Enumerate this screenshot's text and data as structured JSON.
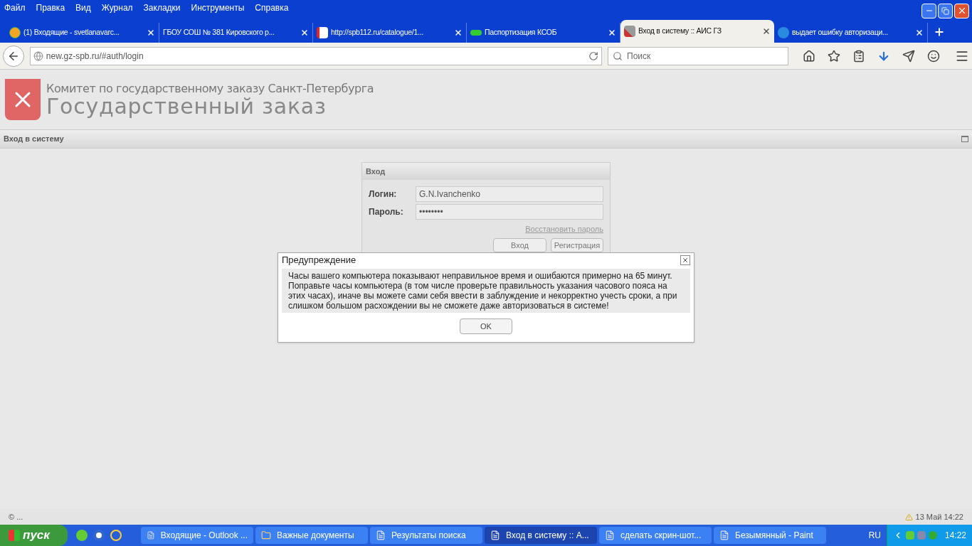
{
  "menu": [
    "Файл",
    "Правка",
    "Вид",
    "Журнал",
    "Закладки",
    "Инструменты",
    "Справка"
  ],
  "tabs": [
    {
      "label": "(1) Входящие - svetlanavarc...",
      "selected": false
    },
    {
      "label": "ГБОУ СОШ № 381 Кировского р...",
      "selected": false
    },
    {
      "label": "http://spb112.ru/catalogue/1...",
      "selected": false
    },
    {
      "label": "Паспортизация КСОБ",
      "selected": false
    },
    {
      "label": "Вход в систему :: АИС ГЗ",
      "selected": true
    },
    {
      "label": "выдает ошибку авторизаци...",
      "selected": false
    }
  ],
  "address": {
    "value": "new.gz-spb.ru/#auth/login"
  },
  "search": {
    "placeholder": "Поиск"
  },
  "header": {
    "org": "Комитет по государственному заказу Санкт-Петербурга",
    "title": "Государственный заказ"
  },
  "section_title": "Вход в систему",
  "login": {
    "title": "Вход",
    "fields": [
      {
        "label": "Логин:",
        "value": "G.N.Ivanchenko"
      },
      {
        "label": "Пароль:",
        "value": "••••••••"
      }
    ],
    "link": "Восстановить пароль",
    "buttons": [
      "Вход",
      "Регистрация"
    ]
  },
  "dialog": {
    "title": "Предупреждение",
    "message": "Часы вашего компьютера показывают неправильное время и ошибаются примерно на 65 минут. Поправьте часы компьютера (в том числе проверьте правильность указания часового пояса на этих часах), иначе вы можете сами себя ввести в заблуждение и некорректно учесть сроки, а при слишком большом расхождении вы не сможете даже авторизоваться в системе!",
    "button": "OK"
  },
  "status": {
    "left": "© ...",
    "right": "13 Май 14:22"
  },
  "taskbar": {
    "start": "пуск",
    "items": [
      {
        "label": "Входящие - Outlook ...",
        "selected": false
      },
      {
        "label": "Важные документы",
        "selected": false
      },
      {
        "label": "Результаты поиска",
        "selected": false
      },
      {
        "label": "Вход в систему :: А...",
        "selected": true
      },
      {
        "label": "сделать скрин-шот...",
        "selected": false
      },
      {
        "label": "Безымянный - Paint",
        "selected": false
      }
    ],
    "lang": "RU",
    "clock": "14:22"
  }
}
